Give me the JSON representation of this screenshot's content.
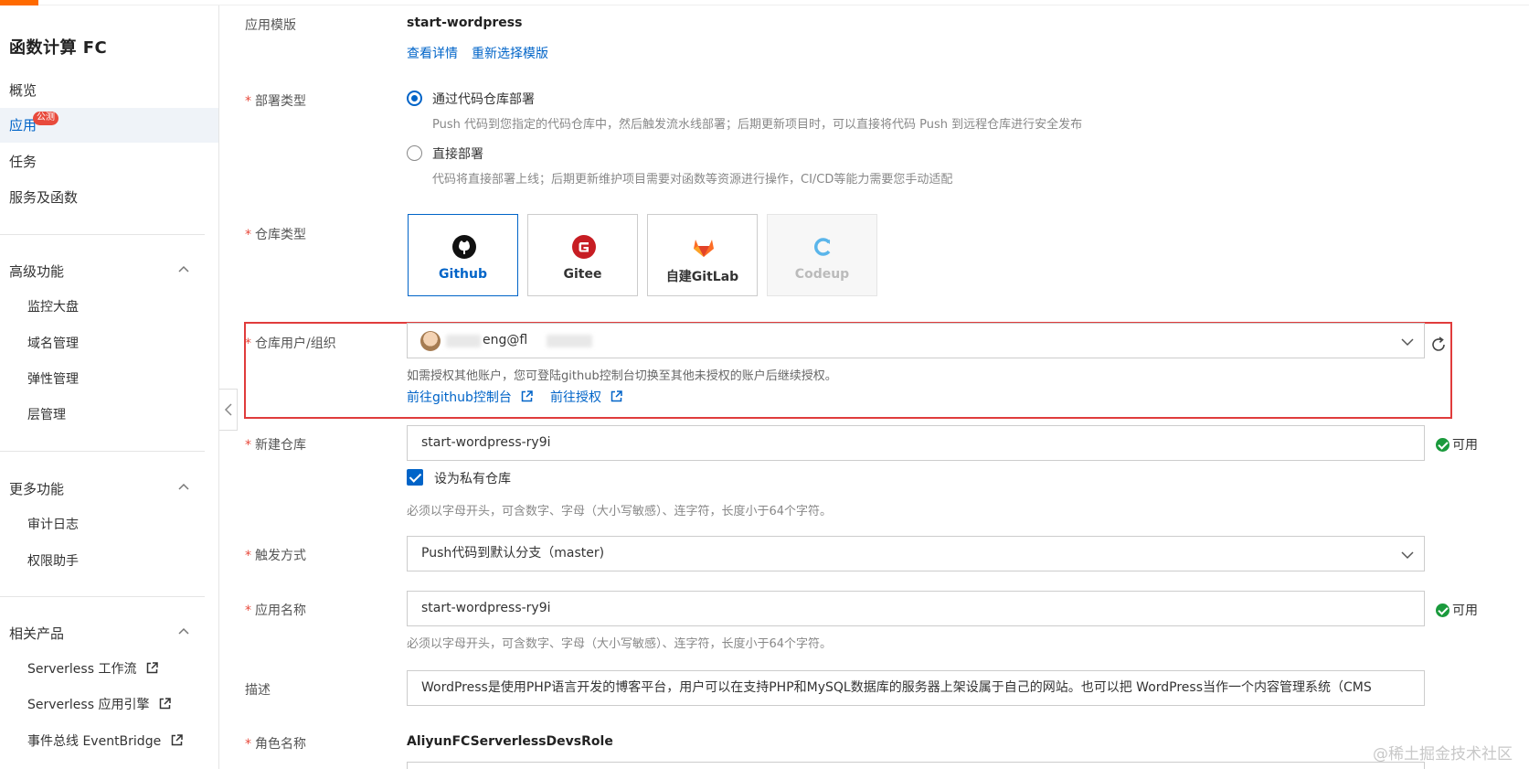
{
  "brand": {
    "accent": "#ff6a00",
    "link": "#0064c8",
    "required": "#e84a3c",
    "success": "#1a9a3c"
  },
  "sidebar": {
    "title": "函数计算 FC",
    "items": [
      {
        "label": "概览"
      },
      {
        "label": "应用",
        "badge": "公测",
        "active": true
      },
      {
        "label": "任务"
      },
      {
        "label": "服务及函数"
      }
    ],
    "groups": [
      {
        "title": "高级功能",
        "items": [
          "监控大盘",
          "域名管理",
          "弹性管理",
          "层管理"
        ]
      },
      {
        "title": "更多功能",
        "items": [
          "审计日志",
          "权限助手"
        ]
      },
      {
        "title": "相关产品",
        "items": [
          "Serverless 工作流",
          "Serverless 应用引擎",
          "事件总线 EventBridge"
        ]
      }
    ]
  },
  "form": {
    "template": {
      "label": "应用模版",
      "value": "start-wordpress",
      "links": [
        "查看详情",
        "重新选择模版"
      ]
    },
    "deploy_type": {
      "label": "部署类型",
      "options": [
        {
          "label": "通过代码仓库部署",
          "hint": "Push 代码到您指定的代码仓库中，然后触发流水线部署；后期更新项目时，可以直接将代码 Push 到远程仓库进行安全发布",
          "checked": true
        },
        {
          "label": "直接部署",
          "hint": "代码将直接部署上线；后期更新维护项目需要对函数等资源进行操作，CI/CD等能力需要您手动适配",
          "checked": false
        }
      ]
    },
    "repo_type": {
      "label": "仓库类型",
      "options": [
        {
          "name": "Github",
          "icon": "github-icon",
          "selected": true
        },
        {
          "name": "Gitee",
          "icon": "gitee-icon"
        },
        {
          "name": "自建GitLab",
          "icon": "gitlab-icon"
        },
        {
          "name": "Codeup",
          "icon": "codeup-icon",
          "disabled": true
        }
      ]
    },
    "repo_user": {
      "label": "仓库用户/组织",
      "value": "eng@fl",
      "hint": "如需授权其他账户，您可登陆github控制台切换至其他未授权的账户后继续授权。",
      "links": [
        "前往github控制台",
        "前往授权"
      ]
    },
    "new_repo": {
      "label": "新建仓库",
      "value": "start-wordpress-ry9i",
      "status": "可用",
      "private_label": "设为私有仓库",
      "private_checked": true,
      "hint": "必须以字母开头，可含数字、字母（大小写敏感）、连字符，长度小于64个字符。"
    },
    "trigger": {
      "label": "触发方式",
      "value": "Push代码到默认分支（master)"
    },
    "app_name": {
      "label": "应用名称",
      "value": "start-wordpress-ry9i",
      "status": "可用",
      "hint": "必须以字母开头，可含数字、字母（大小写敏感）、连字符，长度小于64个字符。"
    },
    "description": {
      "label": "描述",
      "value": "WordPress是使用PHP语言开发的博客平台，用户可以在支持PHP和MySQL数据库的服务器上架设属于自己的网站。也可以把 WordPress当作一个内容管理系统（CMS"
    },
    "role": {
      "label": "角色名称",
      "value": "AliyunFCServerlessDevsRole"
    }
  },
  "watermark": "@稀土掘金技术社区"
}
